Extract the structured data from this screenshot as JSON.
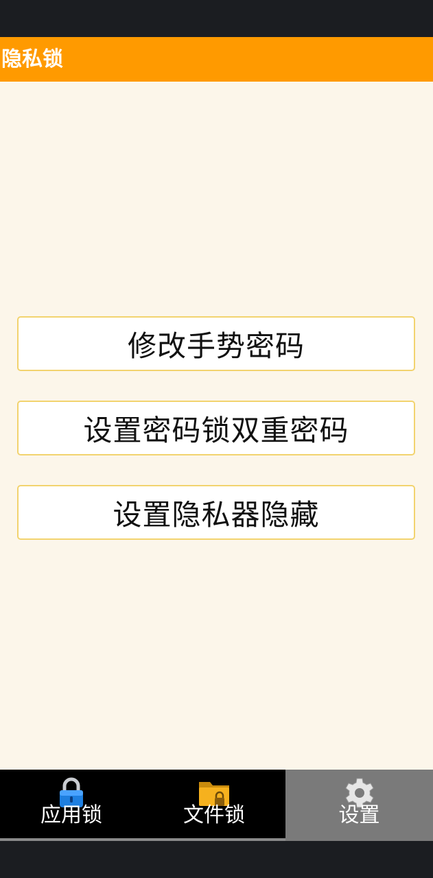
{
  "app": {
    "title": "隐私锁"
  },
  "settings": {
    "options": [
      {
        "label": "修改手势密码"
      },
      {
        "label": "设置密码锁双重密码"
      },
      {
        "label": "设置隐私器隐藏"
      }
    ]
  },
  "bottom_nav": {
    "tabs": [
      {
        "label": "应用锁",
        "icon": "padlock-icon",
        "active": false
      },
      {
        "label": "文件锁",
        "icon": "folder-lock-icon",
        "active": false
      },
      {
        "label": "设置",
        "icon": "gear-icon",
        "active": true
      }
    ]
  },
  "colors": {
    "accent": "#ff9a00",
    "background": "#fcf6ea",
    "button_border": "#f2d36e",
    "nav_background": "#000000",
    "nav_active": "#7a7a7a"
  }
}
